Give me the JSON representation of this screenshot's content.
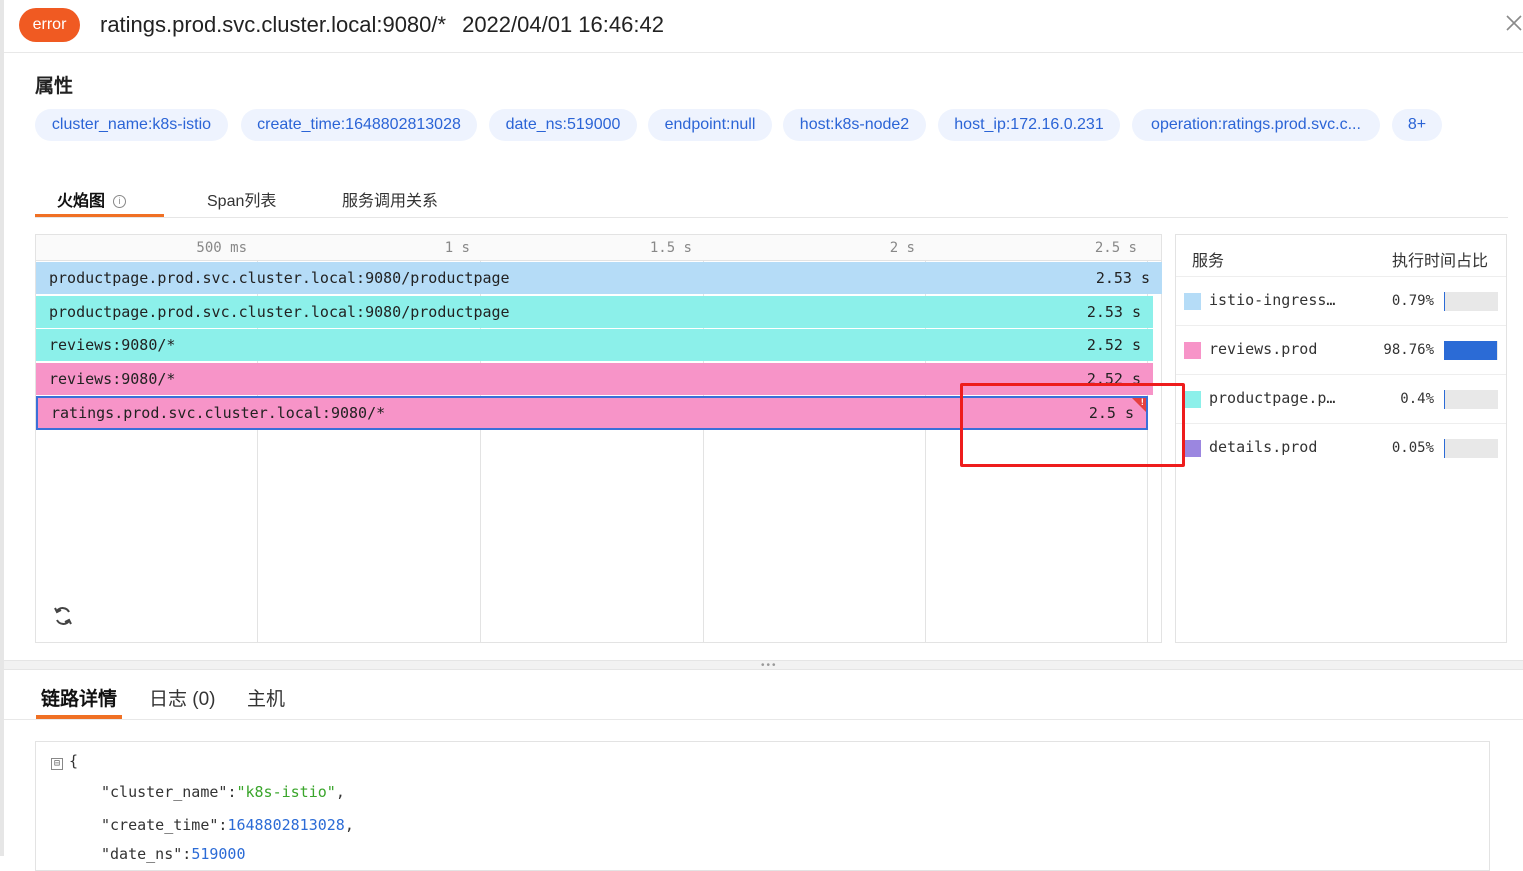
{
  "header": {
    "status_badge": "error",
    "title": "ratings.prod.svc.cluster.local:9080/*",
    "time": "2022/04/01 16:46:42",
    "close_icon": "close-icon"
  },
  "attributes": {
    "label": "属性",
    "tags": [
      "cluster_name:k8s-istio",
      "create_time:1648802813028",
      "date_ns:519000",
      "endpoint:null",
      "host:k8s-node2",
      "host_ip:172.16.0.231",
      "operation:ratings.prod.svc.c...",
      "8+"
    ]
  },
  "tabs": {
    "flame": "火焰图",
    "span_list": "Span列表",
    "service_relation": "服务调用关系"
  },
  "flame_graph": {
    "ticks": [
      "500 ms",
      "1 s",
      "1.5 s",
      "2 s",
      "2.5 s"
    ],
    "spans": [
      {
        "label": "productpage.prod.svc.cluster.local:9080/productpage",
        "duration": "2.53 s",
        "color": "#b5dcf7"
      },
      {
        "label": "productpage.prod.svc.cluster.local:9080/productpage",
        "duration": "2.53 s",
        "color": "#8cf0ea"
      },
      {
        "label": "reviews:9080/*",
        "duration": "2.52 s",
        "color": "#8cf0ea"
      },
      {
        "label": "reviews:9080/*",
        "duration": "2.52 s",
        "color": "#f794c8"
      },
      {
        "label": "ratings.prod.svc.cluster.local:9080/*",
        "duration": "2.5 s",
        "color": "#f794c8",
        "error_flag": "!"
      }
    ],
    "refresh_icon": "refresh-icon"
  },
  "services": {
    "col_service": "服务",
    "col_ratio": "执行时间占比",
    "rows": [
      {
        "name": "istio-ingress…",
        "pct": "0.79%",
        "ratio": 0.0079,
        "color": "#b5dcf7"
      },
      {
        "name": "reviews.prod",
        "pct": "98.76%",
        "ratio": 0.9876,
        "color": "#f794c8"
      },
      {
        "name": "productpage.p…",
        "pct": "0.4%",
        "ratio": 0.004,
        "color": "#8cf0ea"
      },
      {
        "name": "details.prod",
        "pct": "0.05%",
        "ratio": 0.0005,
        "color": "#9b86e0"
      }
    ]
  },
  "bottom_tabs": {
    "trace_detail": "链路详情",
    "logs": "日志 (0)",
    "host": "主机"
  },
  "json_view": {
    "open_brace": "{",
    "collapse_glyph": "⊟",
    "lines": [
      {
        "key": "\"cluster_name\"",
        "sep": ":",
        "value": "\"k8s-istio\"",
        "tail": ",",
        "kind": "string"
      },
      {
        "key": "\"create_time\"",
        "sep": ":",
        "value": "1648802813028",
        "tail": ",",
        "kind": "number"
      },
      {
        "key": "\"date_ns\"",
        "sep": ":",
        "value": "519000",
        "tail": "",
        "kind": "number"
      }
    ]
  },
  "colors": {
    "accent": "#f07024",
    "error": "#f05a22",
    "link_blue": "#2b64d6",
    "highlight_box": "#ee1c1c"
  }
}
